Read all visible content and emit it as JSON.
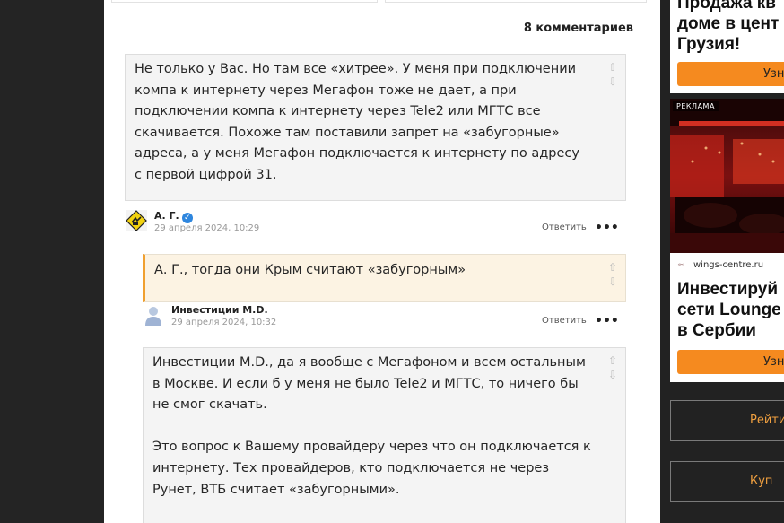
{
  "comments_count": "8 комментариев",
  "comments": [
    {
      "text": "Не только у Вас. Но там все «хитрее». У меня при подключении компа к интернету через Мегафон тоже не дает, а при подключении компа к интернету  через Tele2 или МГТС все скачивается. Похоже там поставили запрет на «забугорные» адреса, а у меня Мегафон подключается к интернету по адресу  с первой цифрой 31.",
      "author": "А. Г.",
      "date": "29 апреля 2024, 10:29",
      "reply_label": "Ответить",
      "more": "•••"
    },
    {
      "text": "А. Г., тогда они Крым считают «забугорным»",
      "author": "Инвестиции M.D.",
      "date": "29 апреля 2024, 10:32",
      "reply_label": "Ответить",
      "more": "•••"
    },
    {
      "paragraph1": "Инвестиции M.D., да я вообще с Мегафоном и всем остальным в Москве. И если б у меня не было Tele2 и МГТС, то ничего бы не смог скачать.",
      "paragraph2": "Это вопрос к Вашему провайдеру через что он подключается к интернету. Тех провайдеров, кто подключается не через Рунет, ВТБ считает «забугорными»."
    }
  ],
  "vote": {
    "up": "⇧",
    "down": "⇩"
  },
  "sidebar": {
    "ad1": {
      "title_lines": [
        "Продажа кв",
        "доме в цент",
        "Грузия!"
      ],
      "button": "Узн"
    },
    "ad2": {
      "label": "РЕКЛАМА",
      "domain": "wings-centre.ru",
      "title_lines": [
        "Инвестируй",
        "сети Lounge",
        "в Сербии"
      ],
      "button": "Узн"
    },
    "buttons": [
      "Рейти",
      "Куп"
    ]
  },
  "colors": {
    "accent": "#f58a1f",
    "reply_border": "#f0a030",
    "verified": "#2e86de"
  }
}
